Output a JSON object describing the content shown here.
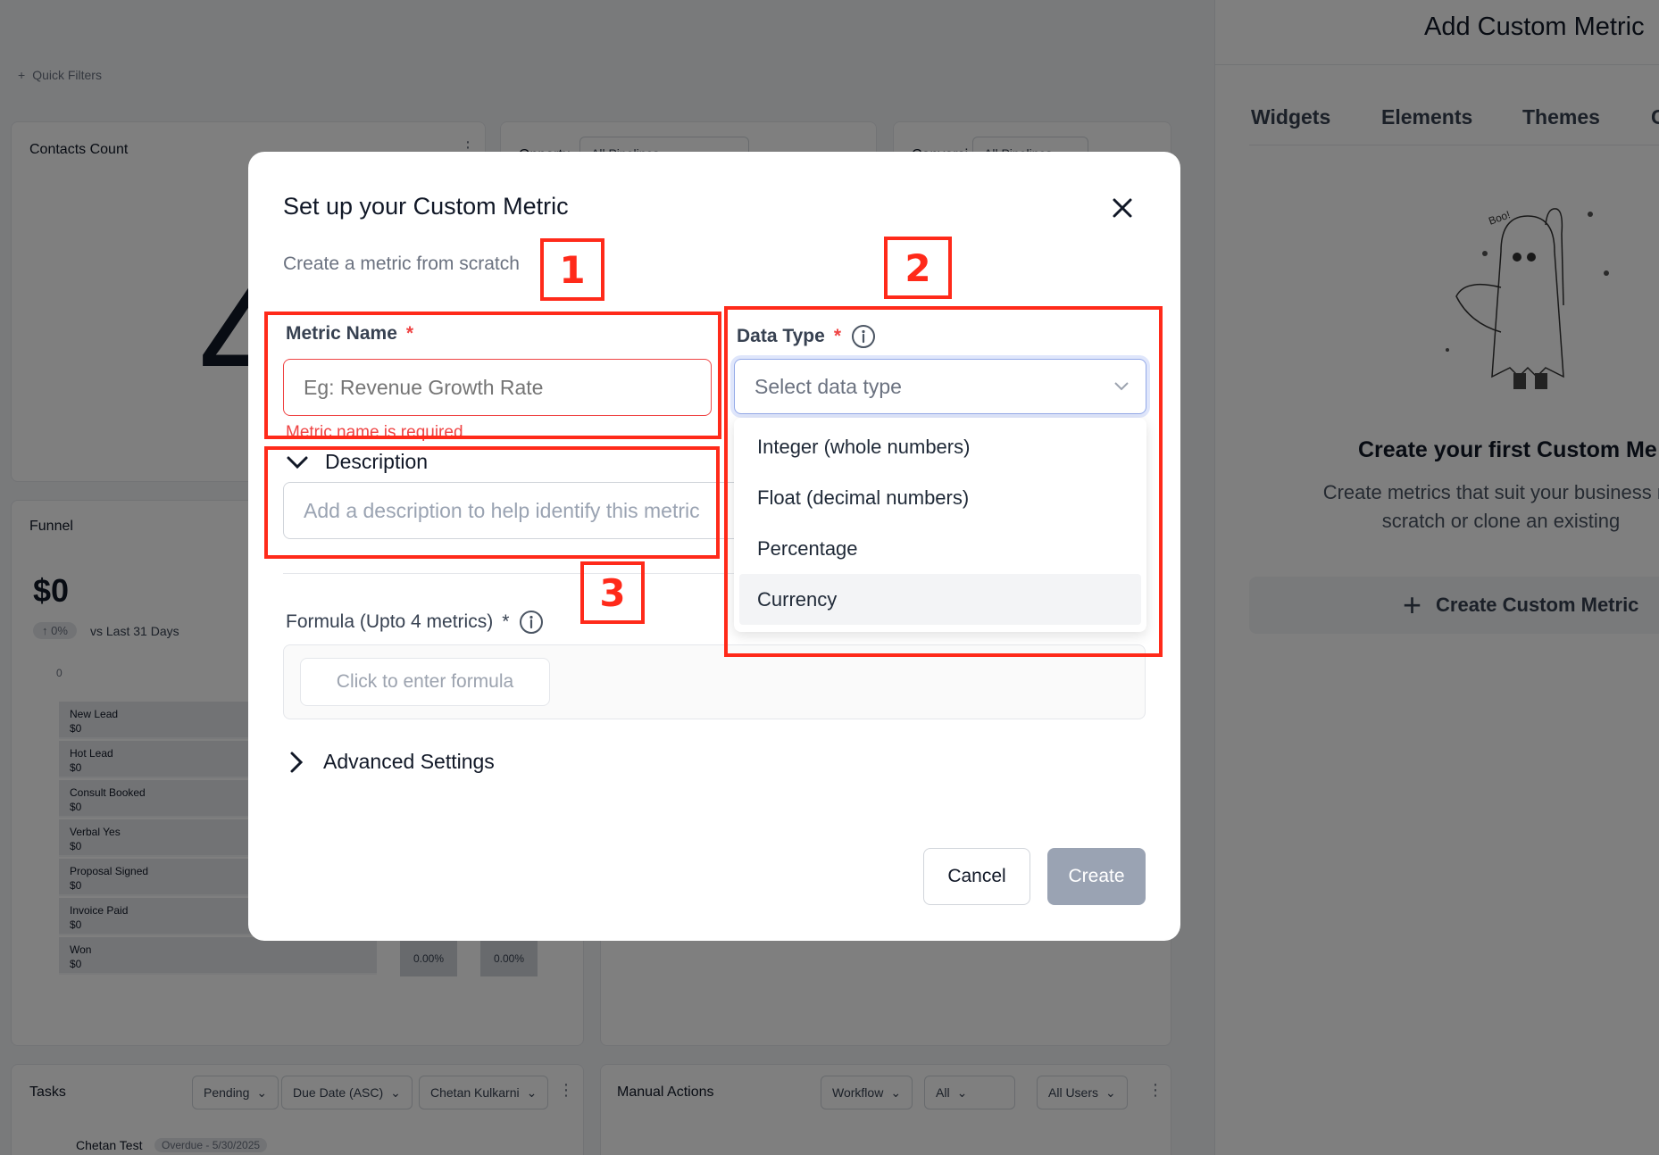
{
  "dashboard": {
    "quick_filters": "Quick Filters",
    "contacts_card": {
      "title": "Contacts Count",
      "value_glyph": "4"
    },
    "opportunities_card": {
      "title": "Opportu",
      "filter": "All Pipelines"
    },
    "conversion_card": {
      "title": "Conversi",
      "filter": "All Pipelines"
    },
    "funnel_card": {
      "title": "Funnel",
      "total": "$0",
      "delta": "0%",
      "compare": "vs Last 31 Days",
      "axis_zero": "0",
      "stages": [
        {
          "name": "New Lead",
          "value": "$0"
        },
        {
          "name": "Hot Lead",
          "value": "$0"
        },
        {
          "name": "Consult Booked",
          "value": "$0"
        },
        {
          "name": "Verbal Yes",
          "value": "$0"
        },
        {
          "name": "Proposal Signed",
          "value": "$0"
        },
        {
          "name": "Invoice Paid",
          "value": "$0"
        },
        {
          "name": "Won",
          "value": "$0"
        }
      ],
      "pct_a": "0.00%",
      "pct_b": "0.00%"
    },
    "tasks_card": {
      "title": "Tasks",
      "filter_status": "Pending",
      "filter_sort": "Due Date (ASC)",
      "filter_user": "Chetan Kulkarni",
      "row_name": "Chetan Test",
      "row_badge": "Overdue - 5/30/2025"
    },
    "manual_actions_card": {
      "title": "Manual Actions",
      "filter_type": "Workflow",
      "filter_all": "All",
      "filter_users": "All Users"
    }
  },
  "right_panel": {
    "title": "Add Custom Metric",
    "tabs": [
      "Widgets",
      "Elements",
      "Themes",
      "C"
    ],
    "illustration_text": "Boo!",
    "empty_heading": "Create your first Custom Me",
    "empty_sub_line1": "Create metrics that suit your business ne",
    "empty_sub_line2": "scratch or clone an existing",
    "create_button": "Create Custom Metric"
  },
  "modal": {
    "title": "Set up your Custom Metric",
    "subtitle": "Create a metric from scratch",
    "metric_name": {
      "label": "Metric Name",
      "required_mark": "*",
      "placeholder": "Eg: Revenue Growth Rate",
      "error": "Metric name is required"
    },
    "data_type": {
      "label": "Data Type",
      "required_mark": "*",
      "placeholder": "Select data type",
      "options": [
        "Integer (whole numbers)",
        "Float (decimal numbers)",
        "Percentage",
        "Currency"
      ]
    },
    "description": {
      "label": "Description",
      "placeholder": "Add a description to help identify this metric"
    },
    "formula": {
      "label": "Formula (Upto 4 metrics)",
      "required_mark": "*",
      "button": "Click to enter formula"
    },
    "advanced_settings": "Advanced Settings",
    "cancel": "Cancel",
    "create": "Create"
  },
  "annotations": [
    "1",
    "2",
    "3"
  ],
  "colors": {
    "annotation": "#ff2a1a",
    "error": "#ef4444",
    "create_disabled": "#9aa3b3"
  }
}
